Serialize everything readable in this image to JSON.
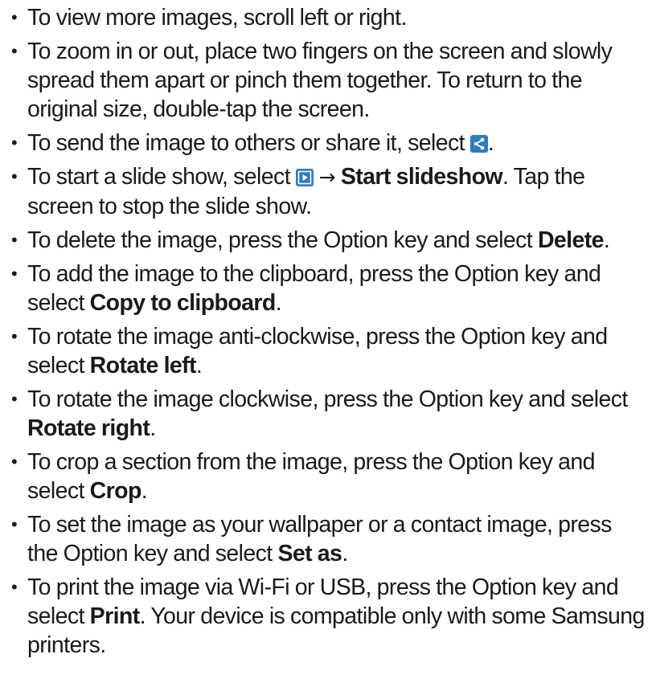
{
  "items": [
    {
      "t1": "To view more images, scroll left or right."
    },
    {
      "t1": "To zoom in or out, place two fingers on the screen and slowly spread them apart or pinch them together. To return to the original size, double-tap the screen."
    },
    {
      "t1": "To send the image to others or share it, select ",
      "icon": "share-icon",
      "t2": "."
    },
    {
      "t1": "To start a slide show, select ",
      "icon": "slideshow-icon",
      "arrow": "→",
      "b1": "Start slideshow",
      "t2": ". Tap the screen to stop the slide show."
    },
    {
      "t1": "To delete the image, press the Option key and select ",
      "b1": "Delete",
      "t2": "."
    },
    {
      "t1": "To add the image to the clipboard, press the Option key and select ",
      "b1": "Copy to clipboard",
      "t2": "."
    },
    {
      "t1": "To rotate the image anti-clockwise, press the Option key and select ",
      "b1": "Rotate left",
      "t2": "."
    },
    {
      "t1": "To rotate the image clockwise, press the Option key and select ",
      "b1": "Rotate right",
      "t2": "."
    },
    {
      "t1": "To crop a section from the image, press the Option key and select ",
      "b1": "Crop",
      "t2": "."
    },
    {
      "t1": "To set the image as your wallpaper or a contact image, press the Option key and select ",
      "b1": "Set as",
      "t2": "."
    },
    {
      "t1": "To print the image via Wi-Fi or USB, press the Option key and select ",
      "b1": "Print",
      "t2": ". Your device is compatible only with some Samsung printers."
    }
  ],
  "bullet_glyph": "•",
  "icon_color": "#2f7dbf"
}
